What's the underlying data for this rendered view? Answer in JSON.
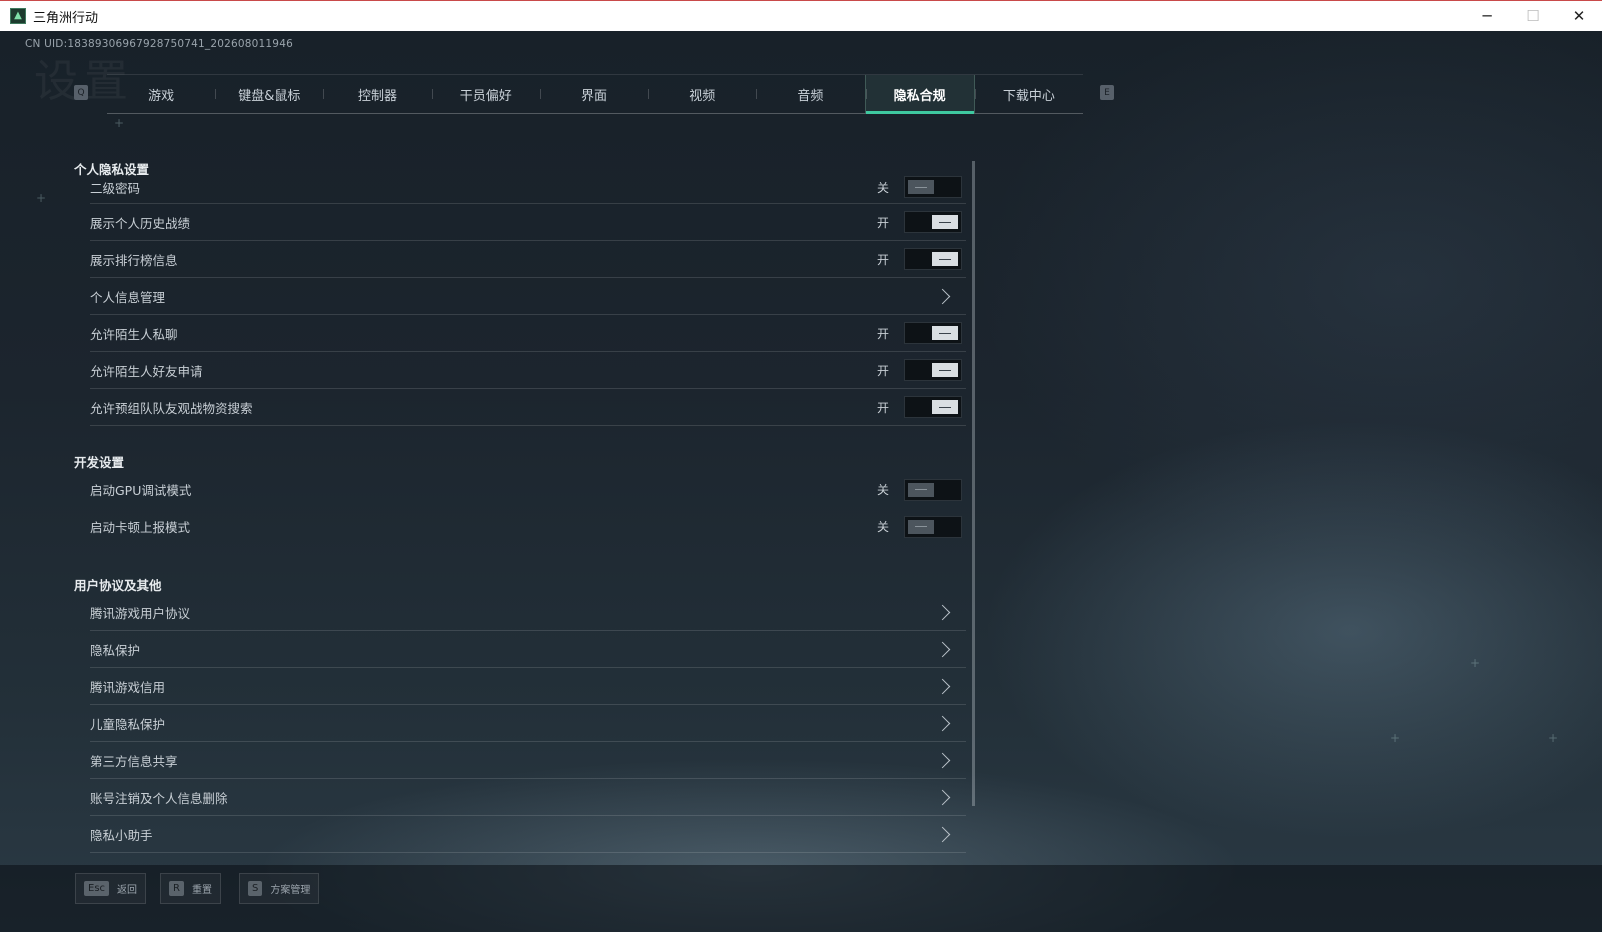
{
  "window": {
    "title": "三角洲行动",
    "minimize": "─",
    "maximize": "☐",
    "close": "✕"
  },
  "uid": "CN UID:18389306967928750741_202608011946",
  "watermark": "设置",
  "tab_keys": {
    "prev": "Q",
    "next": "E"
  },
  "tabs": [
    {
      "label": "游戏"
    },
    {
      "label": "键盘&鼠标"
    },
    {
      "label": "控制器"
    },
    {
      "label": "干员偏好"
    },
    {
      "label": "界面"
    },
    {
      "label": "视频"
    },
    {
      "label": "音频"
    },
    {
      "label": "隐私合规",
      "active": true
    },
    {
      "label": "下载中心"
    }
  ],
  "sections": {
    "privacy": {
      "title": "个人隐私设置",
      "items": [
        {
          "label": "二级密码",
          "state": "关",
          "on": false
        },
        {
          "label": "展示个人历史战绩",
          "state": "开",
          "on": true
        },
        {
          "label": "展示排行榜信息",
          "state": "开",
          "on": true
        },
        {
          "label": "个人信息管理"
        },
        {
          "label": "允许陌生人私聊",
          "state": "开",
          "on": true
        },
        {
          "label": "允许陌生人好友申请",
          "state": "开",
          "on": true
        },
        {
          "label": "允许预组队队友观战物资搜索",
          "state": "开",
          "on": true
        }
      ]
    },
    "dev": {
      "title": "开发设置",
      "items": [
        {
          "label": "启动GPU调试模式",
          "state": "关",
          "on": false
        },
        {
          "label": "启动卡顿上报模式",
          "state": "关",
          "on": false
        }
      ]
    },
    "agreements": {
      "title": "用户协议及其他",
      "items": [
        {
          "label": "腾讯游戏用户协议"
        },
        {
          "label": "隐私保护"
        },
        {
          "label": "腾讯游戏信用"
        },
        {
          "label": "儿童隐私保护"
        },
        {
          "label": "第三方信息共享"
        },
        {
          "label": "账号注销及个人信息删除"
        },
        {
          "label": "隐私小助手"
        }
      ]
    }
  },
  "footer": [
    {
      "key": "Esc",
      "label": "返回"
    },
    {
      "key": "R",
      "label": "重置"
    },
    {
      "key": "S",
      "label": "方案管理"
    }
  ]
}
